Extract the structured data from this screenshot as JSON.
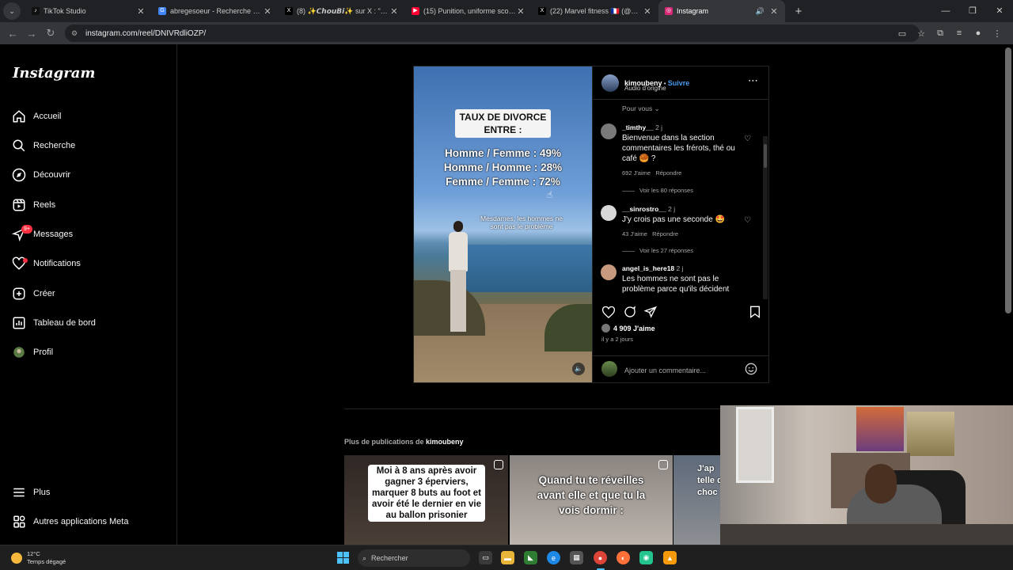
{
  "browser": {
    "tabs": [
      {
        "title": "TikTok Studio",
        "icon": "tiktok-icon",
        "favicon_color": "#111111",
        "favicon_glyph": "♪"
      },
      {
        "title": "abregesoeur - Recherche Goog",
        "icon": "google-icon",
        "favicon_color": "#4285f4",
        "favicon_glyph": "G"
      },
      {
        "title": "(8) ✨𝘾𝙝𝙤𝙪𝘽𝙞✨ sur X : \"@w",
        "icon": "x-icon",
        "favicon_color": "#000000",
        "favicon_glyph": "X"
      },
      {
        "title": "(15) Punition, uniforme scolaire",
        "icon": "youtube-icon",
        "favicon_color": "#ff0033",
        "favicon_glyph": "▶"
      },
      {
        "title": "(22) Marvel fitness 🇫🇷 (@Marvel",
        "icon": "x-icon",
        "favicon_color": "#000000",
        "favicon_glyph": "X"
      },
      {
        "title": "Instagram",
        "icon": "instagram-icon",
        "favicon_color": "#d62976",
        "favicon_glyph": "◎",
        "active": true
      }
    ],
    "url": "instagram.com/reel/DNIVRdliOZP/"
  },
  "sidebar": {
    "logo": "Instagram",
    "items": [
      {
        "label": "Accueil",
        "icon": "home-icon"
      },
      {
        "label": "Recherche",
        "icon": "search-icon"
      },
      {
        "label": "Découvrir",
        "icon": "compass-icon"
      },
      {
        "label": "Reels",
        "icon": "reels-icon"
      },
      {
        "label": "Messages",
        "icon": "messenger-icon",
        "badge": "9+"
      },
      {
        "label": "Notifications",
        "icon": "heart-icon",
        "dot": true
      },
      {
        "label": "Créer",
        "icon": "plus-square-icon"
      },
      {
        "label": "Tableau de bord",
        "icon": "chart-bars-icon"
      },
      {
        "label": "Profil",
        "icon": "avatar-icon"
      }
    ],
    "bottom_items": [
      {
        "label": "Plus",
        "icon": "hamburger-icon"
      },
      {
        "label": "Autres applications Meta",
        "icon": "meta-apps-icon"
      }
    ]
  },
  "reel": {
    "title_line1": "TAUX DE DIVORCE",
    "title_line2": "ENTRE :",
    "stats": [
      "Homme / Femme : 49%",
      "Homme / Homme : 28%",
      "Femme / Femme : 72%"
    ],
    "caption": "Mesdames, les hommes ne sont pas le problème"
  },
  "post": {
    "username": "kimoubeny",
    "separator": " • ",
    "follow_label": "Suivre",
    "audio": "Audio d'origine",
    "sort_label": "Pour vous",
    "comments": [
      {
        "user": "_timthy__",
        "age": "2 j",
        "text": "Bienvenue dans la section commentaires les frérots, thé ou café 🥮 ?",
        "likes": "692 J'aime",
        "reply": "Répondre",
        "replies": "Voir les 80 réponses"
      },
      {
        "user": "__sinrostro__",
        "age": "2 j",
        "text": "J'y crois pas une seconde 🤩",
        "likes": "43 J'aime",
        "reply": "Répondre",
        "replies": "Voir les 27 réponses"
      },
      {
        "user": "angel_is_here18",
        "age": "2 j",
        "text": "Les hommes ne sont pas le problème parce qu'ils décident",
        "likes": "",
        "reply": "",
        "replies": ""
      }
    ],
    "likes_count": "4 909 J'aime",
    "date": "il y a 2 jours",
    "add_comment_placeholder": "Ajouter un commentaire..."
  },
  "more": {
    "label": "Plus de publications de",
    "user": "kimoubeny",
    "thumbs": [
      "Moi à 8 ans après avoir gagner 3 éperviers, marquer 8 buts au foot et avoir été le dernier en vie au ballon prisonier",
      "Quand tu te réveilles avant elle et que tu la vois dormir :",
      "J'ap telle qu choc"
    ]
  },
  "taskbar": {
    "temperature": "12°C",
    "weather": "Temps dégagé",
    "search_label": "Rechercher"
  },
  "colors": {
    "accent_link": "#4a9cf0",
    "badge": "#ff3040",
    "windows_accent": "#4cc2ff"
  }
}
